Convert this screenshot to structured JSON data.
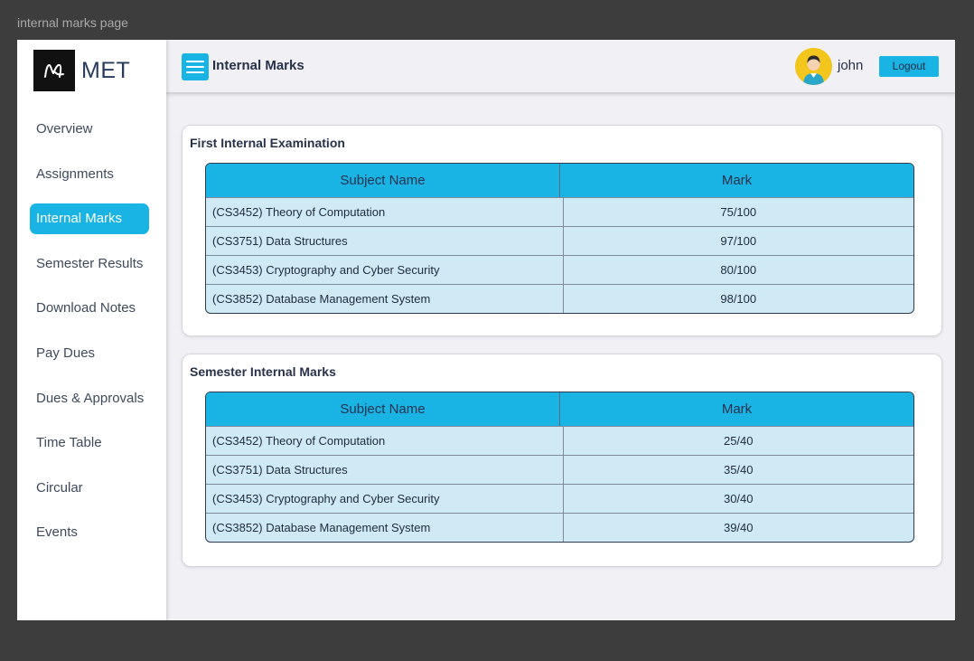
{
  "canvas_label": "internal marks page",
  "brand": {
    "name": "MET",
    "logo_icon": "m-monogram-logo"
  },
  "sidebar": {
    "items": [
      {
        "label": "Overview",
        "active": false
      },
      {
        "label": "Assignments",
        "active": false
      },
      {
        "label": "Internal Marks",
        "active": true
      },
      {
        "label": "Semester Results",
        "active": false
      },
      {
        "label": "Download Notes",
        "active": false
      },
      {
        "label": "Pay Dues",
        "active": false
      },
      {
        "label": "Dues & Approvals",
        "active": false
      },
      {
        "label": "Time Table",
        "active": false
      },
      {
        "label": "Circular",
        "active": false
      },
      {
        "label": "Events",
        "active": false
      }
    ]
  },
  "header": {
    "title": "Internal Marks",
    "menu_icon": "hamburger-menu-icon",
    "user": {
      "name": "john",
      "avatar_icon": "user-avatar-icon"
    },
    "logout_label": "Logout"
  },
  "first_internal": {
    "title": "First Internal Examination",
    "columns": [
      "Subject Name",
      "Mark"
    ],
    "rows": [
      {
        "subject": "(CS3452) Theory of Computation",
        "mark": "75/100"
      },
      {
        "subject": "(CS3751) Data Structures",
        "mark": "97/100"
      },
      {
        "subject": "(CS3453) Cryptography and Cyber Security",
        "mark": "80/100"
      },
      {
        "subject": "(CS3852) Database Management System",
        "mark": "98/100"
      }
    ]
  },
  "semester_internal": {
    "title": "Semester Internal Marks",
    "columns": [
      "Subject Name",
      "Mark"
    ],
    "rows": [
      {
        "subject": "(CS3452) Theory of Computation",
        "mark": "25/40"
      },
      {
        "subject": "(CS3751) Data Structures",
        "mark": "35/40"
      },
      {
        "subject": "(CS3453) Cryptography and Cyber Security",
        "mark": "30/40"
      },
      {
        "subject": "(CS3852) Database Management System",
        "mark": "39/40"
      }
    ]
  },
  "colors": {
    "accent": "#19b4e3",
    "table_row_bg": "#cfeaf5",
    "page_bg": "#f0f0f5",
    "text_dark": "#27324a",
    "avatar_bg": "#f2c61d"
  }
}
